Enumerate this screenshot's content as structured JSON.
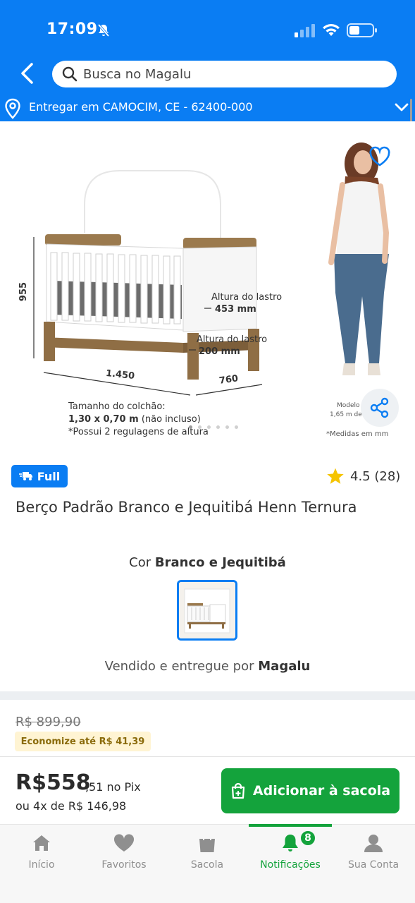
{
  "status_bar": {
    "time": "17:09"
  },
  "search": {
    "placeholder": "Busca no Magalu"
  },
  "delivery": {
    "text": "Entregar em CAMOCIM, CE - 62400-000"
  },
  "image_labels": {
    "height": "955",
    "width": "1.450",
    "depth": "760",
    "lastro_label_1": "Altura do lastro",
    "lastro_value_1": "453 mm",
    "lastro_label_2": "Altura do lastro",
    "lastro_value_2": "200 mm",
    "mattress_title": "Tamanho do colchão:",
    "mattress_size": "1,30 x 0,70 m",
    "mattress_note": "(não incluso)",
    "regulagens": "*Possui 2 regulagens de altura",
    "model_label": "Modelo",
    "model_height": "1,65 m de",
    "measures_note": "*Medidas em mm"
  },
  "product": {
    "badge": "Full",
    "rating": "4.5 (28)",
    "title": "Berço Padrão Branco e Jequitibá Henn Ternura",
    "color_label": "Cor",
    "color_value": "Branco e Jequitibá",
    "sold_by_label": "Vendido e entregue por",
    "sold_by_value": "Magalu"
  },
  "pricing": {
    "old_price": "R$ 899,90",
    "economize": "Economize até R$ 41,39",
    "price_main": "R$558",
    "price_cents": ",51 no Pix",
    "installments": "ou 4x de R$ 146,98"
  },
  "actions": {
    "add_to_bag": "Adicionar à sacola"
  },
  "bottom_nav": {
    "items": [
      {
        "label": "Início",
        "icon": "home-icon"
      },
      {
        "label": "Favoritos",
        "icon": "heart-icon"
      },
      {
        "label": "Sacola",
        "icon": "bag-icon"
      },
      {
        "label": "Notificações",
        "icon": "bell-icon",
        "active": true,
        "badge": "8"
      },
      {
        "label": "Sua Conta",
        "icon": "user-icon"
      }
    ]
  },
  "colors": {
    "brand_blue": "#0a7df3",
    "action_green": "#14a33c"
  }
}
